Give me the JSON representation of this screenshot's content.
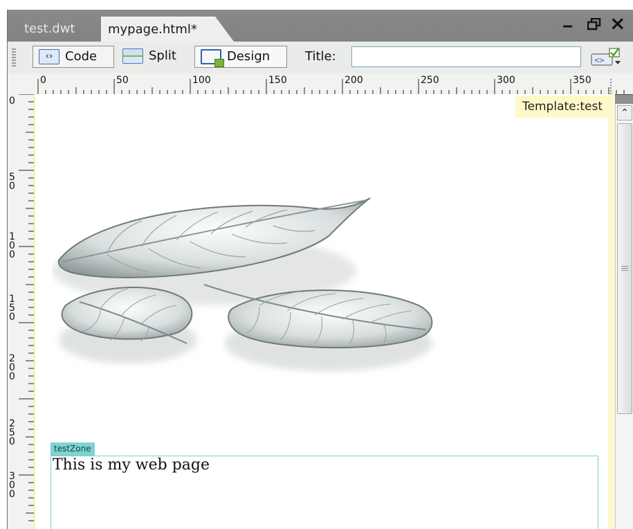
{
  "tabs": [
    {
      "label": "test.dwt",
      "active": false
    },
    {
      "label": "mypage.html*",
      "active": true
    }
  ],
  "window_controls": {
    "minimize": "‒",
    "restore": "◲",
    "close": "×"
  },
  "toolbar": {
    "code_label": "Code",
    "split_label": "Split",
    "design_label": "Design",
    "title_label": "Title:",
    "title_value": "",
    "code_icon_glyph": "‹›"
  },
  "ruler": {
    "horizontal": [
      "0",
      "50",
      "100",
      "150",
      "200",
      "250",
      "300",
      "350"
    ],
    "vertical": [
      "0",
      "50",
      "100",
      "150",
      "200",
      "250",
      "300"
    ]
  },
  "canvas": {
    "template_label": "Template:test",
    "editable_region_name": "testZone",
    "body_text": "This is my web page",
    "image_subject": "leaves-image"
  },
  "scrollbar": {
    "up_arrow": "⌃"
  },
  "colors": {
    "tab_bar": "#8a8a8a",
    "toolbar": "#e9ece8",
    "template_tag_bg": "#fff9c8",
    "zone_tag_bg": "#7fd3d0",
    "zone_border": "#7fcfd0",
    "canvas_margin": "#fbf9cf"
  },
  "icons": [
    "code-view-icon",
    "split-view-icon",
    "design-view-icon",
    "validate-markup-icon",
    "scroll-up-arrow-icon"
  ]
}
